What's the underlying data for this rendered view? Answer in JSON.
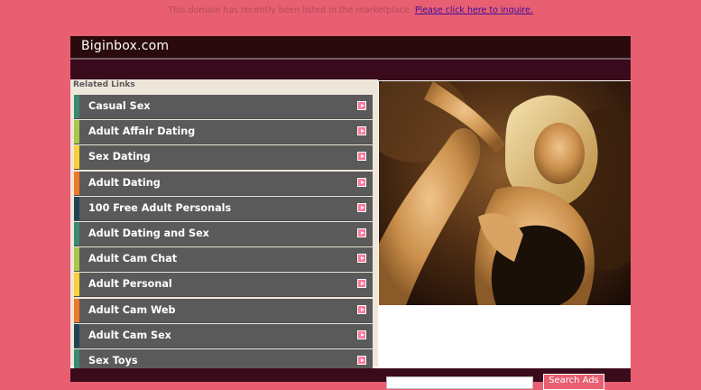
{
  "notice": {
    "text": "This domain has recently been listed in the marketplace.",
    "link_label": "Please click here to inquire."
  },
  "site": {
    "name": "Biginbox.com"
  },
  "related": {
    "title": "Related Links",
    "items": [
      {
        "label": "Casual Sex",
        "color": "#3a8a72"
      },
      {
        "label": "Adult Affair Dating",
        "color": "#a7c84a"
      },
      {
        "label": "Sex Dating",
        "color": "#f5d23a"
      },
      {
        "label": "Adult Dating",
        "color": "#ee7a2a"
      },
      {
        "label": "100 Free Adult Personals",
        "color": "#1f4456"
      },
      {
        "label": "Adult Dating and Sex",
        "color": "#3a8a72"
      },
      {
        "label": "Adult Cam Chat",
        "color": "#a7c84a"
      },
      {
        "label": "Adult Personal",
        "color": "#f5d23a"
      },
      {
        "label": "Adult Cam Web",
        "color": "#ee7a2a"
      },
      {
        "label": "Adult Cam Sex",
        "color": "#1f4456"
      },
      {
        "label": "Sex Toys",
        "color": "#3a8a72"
      }
    ]
  },
  "search": {
    "button_label": "Search Ads"
  },
  "colors": {
    "background": "#e85f72",
    "header": "#2a0a0c",
    "bar": "#3a0b1c",
    "link_bg": "#5a5a5a"
  },
  "icons": {
    "arrow": "arrow-right-icon"
  }
}
